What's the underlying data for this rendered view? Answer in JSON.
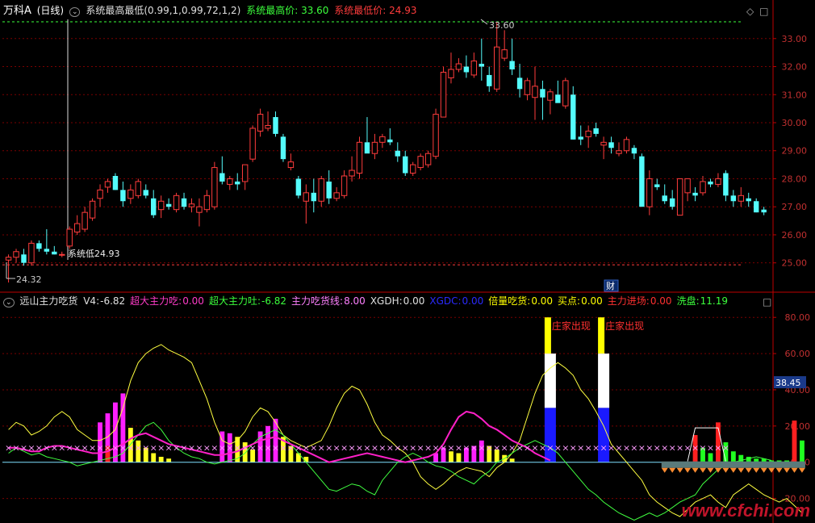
{
  "header_top": {
    "stock": "万科A",
    "period": "(日线)",
    "indicator": "系统最高最低(0.99,1,0.99,72,1,2)",
    "high_label": "系统最高价:",
    "high_value": "33.60",
    "low_label": "系统最低价:",
    "low_value": "24.93"
  },
  "header_bottom": {
    "indicator": "远山主力吃货",
    "items": [
      {
        "label": "V4:",
        "value": "-6.82",
        "color": "#e0e0e0"
      },
      {
        "label": "超大主力吃:",
        "value": "0.00",
        "color": "#ff3cc8"
      },
      {
        "label": "超大主力吐:",
        "value": "-6.82",
        "color": "#3cff3c"
      },
      {
        "label": "主力吃货线:",
        "value": "8.00",
        "color": "#ff80ff"
      },
      {
        "label": "XGDH:",
        "value": "0.00",
        "color": "#e0e0e0"
      },
      {
        "label": "XGDC:",
        "value": "0.00",
        "color": "#2a2aff"
      },
      {
        "label": "倍量吃货:",
        "value": "0.00",
        "color": "#ffff00"
      },
      {
        "label": "买点:",
        "value": "0.00",
        "color": "#ffff00"
      },
      {
        "label": "主力进场:",
        "value": "0.00",
        "color": "#ff3030"
      },
      {
        "label": "洗盘:",
        "value": "11.19",
        "color": "#3cff3c"
      }
    ]
  },
  "annotations": {
    "high_mark": "33.60",
    "low_mark": "系统低24.93",
    "min_mark": "24.32",
    "cai": "财",
    "zhuang1": "庄家出现",
    "zhuang2": "庄家出现",
    "cursor_value": "38.45"
  },
  "watermark": "www.cfchi.com",
  "colors": {
    "up": "#ff3c3c",
    "down": "#54fcfc",
    "grid": "#7a0000",
    "axis": "#c00000"
  },
  "chart_data": [
    {
      "type": "candlestick",
      "title": "万科A (日线)",
      "ylim": [
        24.3,
        33.8
      ],
      "yticks": [
        25.0,
        26.0,
        27.0,
        28.0,
        29.0,
        30.0,
        31.0,
        32.0,
        33.0
      ],
      "high": 33.6,
      "low": 24.93,
      "min": 24.32,
      "candles": [
        [
          25.1,
          25.3,
          24.3,
          25.2
        ],
        [
          25.2,
          25.5,
          25.0,
          25.4
        ],
        [
          25.3,
          25.5,
          24.9,
          25.0
        ],
        [
          25.0,
          25.8,
          24.9,
          25.7
        ],
        [
          25.7,
          25.8,
          25.4,
          25.5
        ],
        [
          25.5,
          26.2,
          25.3,
          25.4
        ],
        [
          25.4,
          25.6,
          25.3,
          25.3
        ],
        [
          25.3,
          25.4,
          25.2,
          25.3
        ],
        [
          25.6,
          26.3,
          25.5,
          26.2
        ],
        [
          26.1,
          26.7,
          26.0,
          26.4
        ],
        [
          26.2,
          27.0,
          26.1,
          26.8
        ],
        [
          26.6,
          27.3,
          26.5,
          27.2
        ],
        [
          27.3,
          27.8,
          27.0,
          27.6
        ],
        [
          27.7,
          28.0,
          27.5,
          27.9
        ],
        [
          28.1,
          28.2,
          27.6,
          27.6
        ],
        [
          27.6,
          27.9,
          27.0,
          27.2
        ],
        [
          27.3,
          27.8,
          27.1,
          27.6
        ],
        [
          27.4,
          28.0,
          27.3,
          27.9
        ],
        [
          27.6,
          27.8,
          27.3,
          27.4
        ],
        [
          27.3,
          27.6,
          26.6,
          26.7
        ],
        [
          26.9,
          27.4,
          26.6,
          27.2
        ],
        [
          27.1,
          27.3,
          26.9,
          27.0
        ],
        [
          26.9,
          27.5,
          26.8,
          27.4
        ],
        [
          27.3,
          27.5,
          26.9,
          27.0
        ],
        [
          27.0,
          27.3,
          26.8,
          27.1
        ],
        [
          26.8,
          27.3,
          26.3,
          27.0
        ],
        [
          26.9,
          27.6,
          26.8,
          27.4
        ],
        [
          27.0,
          28.6,
          26.9,
          28.4
        ],
        [
          28.2,
          28.8,
          27.8,
          27.9
        ],
        [
          27.8,
          28.1,
          27.6,
          28.0
        ],
        [
          27.9,
          28.2,
          27.6,
          27.8
        ],
        [
          27.9,
          28.5,
          27.6,
          28.5
        ],
        [
          28.7,
          29.9,
          28.6,
          29.8
        ],
        [
          29.7,
          30.5,
          29.5,
          30.3
        ],
        [
          29.8,
          30.4,
          29.7,
          29.9
        ],
        [
          30.2,
          30.4,
          29.5,
          29.6
        ],
        [
          29.5,
          29.6,
          28.6,
          28.7
        ],
        [
          28.4,
          28.9,
          28.3,
          28.6
        ],
        [
          28.0,
          28.1,
          27.3,
          27.4
        ],
        [
          27.2,
          27.8,
          26.4,
          27.5
        ],
        [
          27.5,
          28.0,
          26.8,
          27.2
        ],
        [
          27.2,
          28.1,
          27.0,
          28.0
        ],
        [
          27.9,
          28.3,
          27.1,
          27.3
        ],
        [
          27.3,
          27.7,
          27.2,
          27.5
        ],
        [
          27.4,
          28.3,
          27.3,
          28.1
        ],
        [
          28.1,
          28.8,
          27.9,
          28.3
        ],
        [
          28.2,
          29.5,
          28.0,
          29.3
        ],
        [
          29.3,
          30.2,
          29.1,
          28.9
        ],
        [
          28.9,
          29.6,
          28.7,
          29.3
        ],
        [
          29.3,
          29.6,
          29.1,
          29.5
        ],
        [
          29.4,
          29.8,
          29.2,
          29.3
        ],
        [
          29.0,
          29.3,
          28.6,
          28.8
        ],
        [
          28.8,
          29.0,
          28.1,
          28.2
        ],
        [
          28.2,
          28.6,
          28.1,
          28.5
        ],
        [
          28.4,
          28.9,
          28.3,
          28.8
        ],
        [
          28.5,
          29.0,
          28.4,
          28.9
        ],
        [
          28.8,
          30.5,
          28.7,
          30.3
        ],
        [
          30.2,
          32.0,
          30.2,
          31.8
        ],
        [
          31.6,
          32.5,
          31.4,
          31.9
        ],
        [
          31.9,
          32.3,
          31.8,
          32.1
        ],
        [
          32.0,
          32.4,
          31.6,
          31.8
        ],
        [
          31.7,
          32.5,
          31.6,
          32.2
        ],
        [
          32.1,
          33.0,
          31.5,
          32.0
        ],
        [
          31.7,
          32.0,
          31.1,
          31.3
        ],
        [
          31.2,
          33.6,
          31.1,
          32.7
        ],
        [
          32.3,
          33.3,
          32.2,
          32.6
        ],
        [
          32.2,
          33.0,
          31.7,
          31.9
        ],
        [
          31.6,
          32.1,
          30.9,
          31.2
        ],
        [
          31.0,
          31.6,
          30.8,
          31.5
        ],
        [
          30.9,
          32.0,
          30.1,
          31.3
        ],
        [
          31.2,
          31.5,
          30.1,
          30.9
        ],
        [
          30.8,
          31.2,
          30.3,
          31.1
        ],
        [
          31.0,
          31.5,
          30.8,
          30.7
        ],
        [
          30.6,
          31.6,
          30.5,
          31.5
        ],
        [
          31.0,
          31.3,
          29.4,
          29.4
        ],
        [
          29.5,
          29.9,
          29.2,
          29.4
        ],
        [
          29.5,
          29.9,
          29.1,
          29.7
        ],
        [
          29.8,
          30.0,
          29.5,
          29.6
        ],
        [
          29.2,
          29.5,
          28.7,
          29.3
        ],
        [
          29.3,
          29.5,
          28.9,
          29.1
        ],
        [
          28.9,
          29.3,
          28.8,
          29.0
        ],
        [
          29.0,
          29.5,
          28.9,
          29.4
        ],
        [
          29.1,
          29.2,
          28.7,
          28.9
        ],
        [
          28.8,
          28.9,
          27.4,
          27.0
        ],
        [
          27.0,
          28.3,
          26.7,
          28.0
        ],
        [
          27.8,
          28.0,
          27.6,
          27.7
        ],
        [
          27.4,
          27.8,
          27.1,
          27.2
        ],
        [
          27.3,
          27.6,
          26.9,
          27.0
        ],
        [
          26.7,
          28.0,
          26.7,
          28.0
        ],
        [
          27.5,
          28.0,
          27.2,
          28.0
        ],
        [
          27.5,
          27.7,
          27.2,
          27.4
        ],
        [
          27.5,
          28.1,
          27.4,
          27.9
        ],
        [
          27.9,
          28.0,
          27.7,
          27.8
        ],
        [
          27.8,
          28.2,
          27.7,
          28.0
        ],
        [
          28.2,
          28.3,
          27.2,
          27.4
        ],
        [
          27.4,
          27.6,
          27.0,
          27.2
        ],
        [
          27.2,
          27.7,
          27.0,
          27.4
        ],
        [
          27.3,
          27.5,
          27.0,
          27.2
        ],
        [
          27.2,
          27.3,
          26.8,
          26.8
        ],
        [
          26.9,
          27.0,
          26.7,
          26.8
        ]
      ]
    },
    {
      "type": "bar",
      "title": "远山主力吃货",
      "ylim": [
        -30,
        85
      ],
      "yticks": [
        -20.0,
        0.0,
        20.0,
        40.0,
        60.0,
        80.0
      ],
      "cross_level": 8,
      "series": [
        {
          "name": "超大主力吃",
          "color": "#ff20ff",
          "points": [
            [
              12,
              22
            ],
            [
              13,
              27
            ],
            [
              14,
              33
            ],
            [
              15,
              38
            ],
            [
              28,
              17
            ],
            [
              29,
              16
            ],
            [
              33,
              17
            ],
            [
              34,
              20
            ],
            [
              35,
              24
            ],
            [
              56,
              5
            ],
            [
              57,
              8
            ],
            [
              60,
              8
            ],
            [
              61,
              9
            ],
            [
              62,
              12
            ]
          ]
        },
        {
          "name": "倍量吃货",
          "color": "#ffff20",
          "points": [
            [
              16,
              19
            ],
            [
              17,
              12
            ],
            [
              18,
              8
            ],
            [
              19,
              5
            ],
            [
              20,
              3
            ],
            [
              21,
              2
            ],
            [
              30,
              14
            ],
            [
              31,
              11
            ],
            [
              32,
              7
            ],
            [
              36,
              14
            ],
            [
              37,
              9
            ],
            [
              38,
              5
            ],
            [
              39,
              3
            ],
            [
              58,
              6
            ],
            [
              59,
              5
            ],
            [
              63,
              9
            ],
            [
              64,
              7
            ],
            [
              65,
              4
            ],
            [
              66,
              2
            ]
          ]
        },
        {
          "name": "主力进场",
          "color": "#ff2020",
          "points": [
            [
              13,
              9
            ],
            [
              90,
              15
            ],
            [
              93,
              22
            ],
            [
              103,
              23
            ]
          ]
        },
        {
          "name": "洗盘",
          "color": "#20ff20",
          "points": [
            [
              91,
              8
            ],
            [
              92,
              5
            ],
            [
              94,
              11
            ],
            [
              95,
              6
            ],
            [
              96,
              4
            ],
            [
              97,
              3
            ],
            [
              98,
              2
            ],
            [
              99,
              2
            ],
            [
              100,
              1
            ],
            [
              101,
              1
            ],
            [
              102,
              1
            ],
            [
              104,
              12
            ]
          ]
        },
        {
          "name": "XGDC",
          "color": "#1a1aff",
          "points": [
            [
              71,
              30
            ],
            [
              78,
              30
            ]
          ]
        }
      ],
      "lines": {
        "yellow": [
          18,
          22,
          20,
          15,
          17,
          20,
          25,
          28,
          25,
          18,
          15,
          12,
          12,
          14,
          18,
          30,
          45,
          55,
          60,
          63,
          65,
          62,
          60,
          58,
          55,
          45,
          35,
          22,
          12,
          10,
          12,
          17,
          25,
          30,
          28,
          22,
          15,
          12,
          10,
          8,
          10,
          12,
          20,
          30,
          38,
          42,
          40,
          32,
          22,
          15,
          12,
          8,
          5,
          0,
          -8,
          -12,
          -15,
          -12,
          -8,
          -5,
          -3,
          -4,
          -5,
          -8,
          -3,
          0,
          5,
          12,
          25,
          38,
          48,
          52,
          55,
          52,
          48,
          40,
          35,
          28,
          20,
          10,
          5,
          0,
          -5,
          -10,
          -18,
          -22,
          -25,
          -28,
          -30,
          -26,
          -22,
          -20,
          -18,
          -22,
          -25,
          -18,
          -15,
          -12,
          -15,
          -18,
          -20,
          -22,
          -20,
          -24,
          -28
        ],
        "green": [
          5,
          8,
          6,
          4,
          5,
          3,
          2,
          1,
          0,
          -2,
          -1,
          0,
          1,
          2,
          3,
          5,
          10,
          15,
          20,
          22,
          18,
          12,
          8,
          5,
          3,
          2,
          0,
          -1,
          0,
          1,
          2,
          5,
          10,
          14,
          16,
          18,
          15,
          10,
          5,
          0,
          -5,
          -10,
          -15,
          -16,
          -14,
          -12,
          -13,
          -16,
          -18,
          -10,
          -5,
          0,
          3,
          5,
          3,
          0,
          -2,
          -3,
          -5,
          -8,
          -10,
          -12,
          -8,
          -5,
          0,
          2,
          5,
          8,
          10,
          12,
          10,
          8,
          5,
          0,
          -5,
          -10,
          -15,
          -18,
          -22,
          -25,
          -28,
          -30,
          -32,
          -30,
          -28,
          -30,
          -28,
          -25,
          -22,
          -20,
          -18,
          -12,
          -8,
          -4,
          -2,
          0,
          1,
          2,
          3,
          2,
          1
        ],
        "pink": [
          8,
          8,
          7,
          6,
          6,
          8,
          9,
          9,
          8,
          7,
          6,
          5,
          5,
          6,
          8,
          10,
          13,
          15,
          16,
          14,
          12,
          10,
          9,
          8,
          7,
          6,
          5,
          4,
          4,
          5,
          6,
          8,
          10,
          12,
          13,
          14,
          12,
          10,
          8,
          6,
          4,
          2,
          0,
          1,
          2,
          3,
          4,
          5,
          4,
          3,
          2,
          1,
          0,
          1,
          2,
          3,
          5,
          10,
          18,
          25,
          28,
          27,
          24,
          20,
          18,
          15,
          12,
          10,
          8,
          5,
          3,
          1
        ]
      }
    }
  ]
}
